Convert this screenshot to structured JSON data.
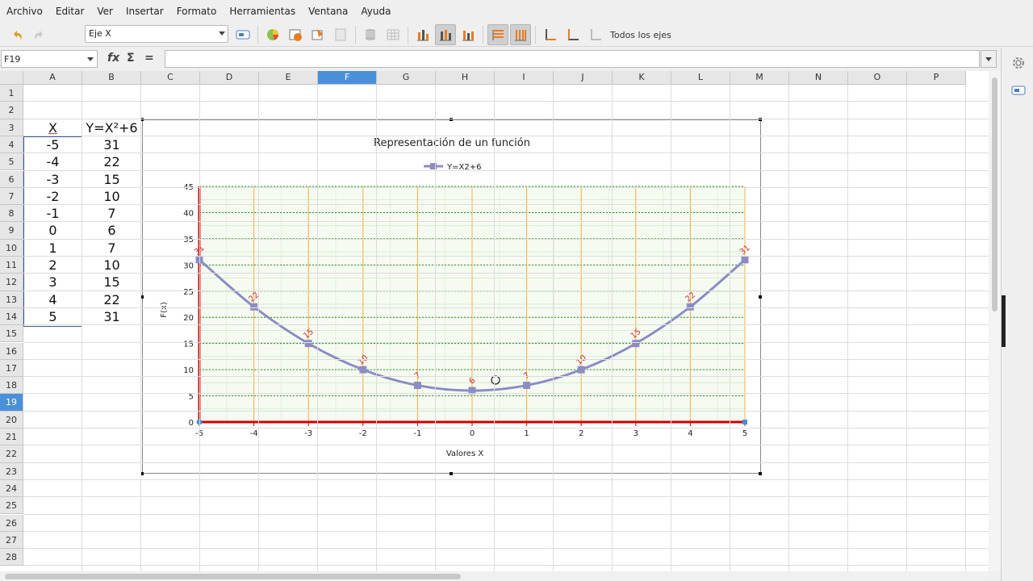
{
  "menu": [
    "Archivo",
    "Editar",
    "Ver",
    "Insertar",
    "Formato",
    "Herramientas",
    "Ventana",
    "Ayuda"
  ],
  "toolbar": {
    "element_select": "Eje X",
    "all_axes_label": "Todos los ejes"
  },
  "formula_bar": {
    "name_box": "F19",
    "fx_label": "fx",
    "sum_label": "Σ",
    "equals_label": "=",
    "content": ""
  },
  "columns": [
    "A",
    "B",
    "C",
    "D",
    "E",
    "F",
    "G",
    "H",
    "I",
    "J",
    "K",
    "L",
    "M",
    "N",
    "O",
    "P"
  ],
  "selected_column": "F",
  "selected_row": "19",
  "rows": [
    "1",
    "2",
    "3",
    "4",
    "5",
    "6",
    "7",
    "8",
    "9",
    "10",
    "11",
    "12",
    "13",
    "14",
    "15",
    "16",
    "17",
    "18",
    "19",
    "20",
    "21",
    "22",
    "23",
    "24",
    "25",
    "26",
    "27",
    "28"
  ],
  "sheet": {
    "header_x": "X",
    "header_y": "Y=X²+6",
    "x_values": [
      "-5",
      "-4",
      "-3",
      "-2",
      "-1",
      "0",
      "1",
      "2",
      "3",
      "4",
      "5"
    ],
    "y_values": [
      "31",
      "22",
      "15",
      "10",
      "7",
      "6",
      "7",
      "10",
      "15",
      "22",
      "31"
    ]
  },
  "chart_data": {
    "type": "line",
    "title": "Representación de un función",
    "xlabel": "Valores X",
    "ylabel": "F(x)",
    "x": [
      -5,
      -4,
      -3,
      -2,
      -1,
      0,
      1,
      2,
      3,
      4,
      5
    ],
    "series": [
      {
        "name": "Y=X2+6",
        "values": [
          31,
          22,
          15,
          10,
          7,
          6,
          7,
          10,
          15,
          22,
          31
        ],
        "color": "#8c8cc4"
      }
    ],
    "xlim": [
      -5,
      5
    ],
    "ylim": [
      0,
      45
    ],
    "y_ticks": [
      0,
      5,
      10,
      15,
      20,
      25,
      30,
      35,
      40,
      45
    ],
    "legend": "top-center",
    "grid": true,
    "axis_color": "#cc0000",
    "vertical_grid_color": "#f5b041",
    "horizontal_grid_color": "#2e8b2e",
    "data_label_color": "#cc3333"
  }
}
